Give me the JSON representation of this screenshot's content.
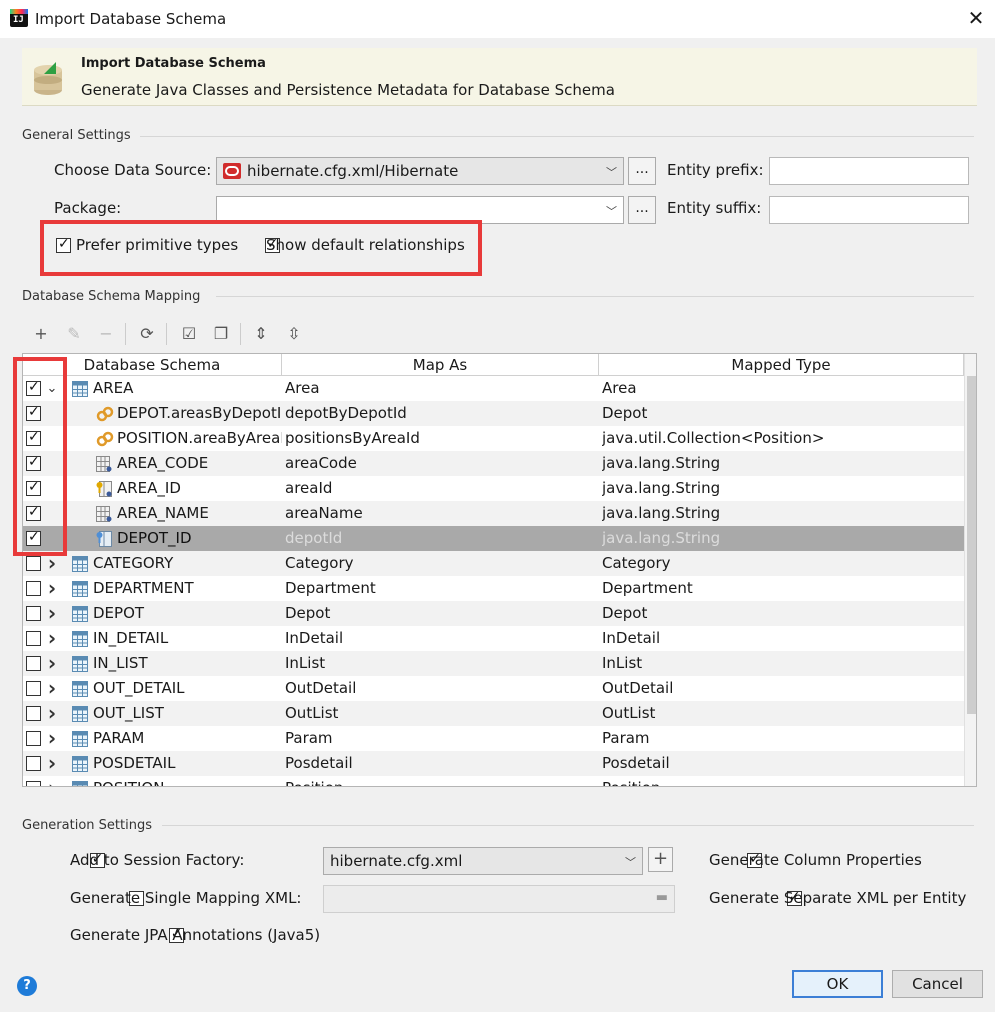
{
  "window": {
    "title": "Import Database Schema",
    "close_glyph": "✕"
  },
  "banner": {
    "title": "Import Database Schema",
    "subtitle": "Generate Java Classes and Persistence Metadata for Database Schema"
  },
  "general": {
    "section_label": "General Settings",
    "data_source_label": "Choose Data Source:",
    "data_source_value": "hibernate.cfg.xml/Hibernate",
    "package_label": "Package:",
    "package_value": "",
    "entity_prefix_label": "Entity prefix:",
    "entity_prefix_value": "",
    "entity_suffix_label": "Entity suffix:",
    "entity_suffix_value": "",
    "browse_label": "...",
    "prefer_primitive": {
      "label": "Prefer primitive types",
      "checked": true
    },
    "show_default_rel": {
      "label": "Show default relationships",
      "checked": true
    }
  },
  "mapping": {
    "section_label": "Database Schema Mapping",
    "toolbar": [
      "add-icon",
      "edit-icon",
      "remove-icon",
      "refresh-icon",
      "check-all-icon",
      "uncheck-all-icon",
      "expand-all-icon",
      "collapse-all-icon"
    ],
    "columns": [
      "Database Schema",
      "Map As",
      "Mapped Type"
    ],
    "rows": [
      {
        "checked": true,
        "expand": "v",
        "indent": 0,
        "icon": "table",
        "schema": "AREA",
        "map_as": "Area",
        "type": "Area"
      },
      {
        "checked": true,
        "expand": "",
        "indent": 1,
        "icon": "relation",
        "schema": "DEPOT.areasByDepotId",
        "map_as": "depotByDepotId",
        "type": "Depot"
      },
      {
        "checked": true,
        "expand": "",
        "indent": 1,
        "icon": "relation",
        "schema": "POSITION.areaByAreaId",
        "map_as": "positionsByAreaId",
        "type": "java.util.Collection<Position>"
      },
      {
        "checked": true,
        "expand": "",
        "indent": 1,
        "icon": "column",
        "schema": "AREA_CODE",
        "map_as": "areaCode",
        "type": "java.lang.String"
      },
      {
        "checked": true,
        "expand": "",
        "indent": 1,
        "icon": "key-column",
        "schema": "AREA_ID",
        "map_as": "areaId",
        "type": "java.lang.String"
      },
      {
        "checked": true,
        "expand": "",
        "indent": 1,
        "icon": "column",
        "schema": "AREA_NAME",
        "map_as": "areaName",
        "type": "java.lang.String"
      },
      {
        "checked": true,
        "expand": "",
        "indent": 1,
        "icon": "fk-column",
        "schema": "DEPOT_ID",
        "map_as": "depotId",
        "type": "java.lang.String",
        "selected": true
      },
      {
        "checked": false,
        "expand": ">",
        "indent": 0,
        "icon": "table",
        "schema": "CATEGORY",
        "map_as": "Category",
        "type": "Category"
      },
      {
        "checked": false,
        "expand": ">",
        "indent": 0,
        "icon": "table",
        "schema": "DEPARTMENT",
        "map_as": "Department",
        "type": "Department"
      },
      {
        "checked": false,
        "expand": ">",
        "indent": 0,
        "icon": "table",
        "schema": "DEPOT",
        "map_as": "Depot",
        "type": "Depot"
      },
      {
        "checked": false,
        "expand": ">",
        "indent": 0,
        "icon": "table",
        "schema": "IN_DETAIL",
        "map_as": "InDetail",
        "type": "InDetail"
      },
      {
        "checked": false,
        "expand": ">",
        "indent": 0,
        "icon": "table",
        "schema": "IN_LIST",
        "map_as": "InList",
        "type": "InList"
      },
      {
        "checked": false,
        "expand": ">",
        "indent": 0,
        "icon": "table",
        "schema": "OUT_DETAIL",
        "map_as": "OutDetail",
        "type": "OutDetail"
      },
      {
        "checked": false,
        "expand": ">",
        "indent": 0,
        "icon": "table",
        "schema": "OUT_LIST",
        "map_as": "OutList",
        "type": "OutList"
      },
      {
        "checked": false,
        "expand": ">",
        "indent": 0,
        "icon": "table",
        "schema": "PARAM",
        "map_as": "Param",
        "type": "Param"
      },
      {
        "checked": false,
        "expand": ">",
        "indent": 0,
        "icon": "table",
        "schema": "POSDETAIL",
        "map_as": "Posdetail",
        "type": "Posdetail"
      },
      {
        "checked": false,
        "expand": ">",
        "indent": 0,
        "icon": "table",
        "schema": "POSITION",
        "map_as": "Position",
        "type": "Position"
      }
    ]
  },
  "generation": {
    "section_label": "Generation Settings",
    "add_session_factory": {
      "label": "Add to Session Factory:",
      "checked": true
    },
    "session_factory_value": "hibernate.cfg.xml",
    "single_mapping_xml": {
      "label": "Generate Single Mapping XML:",
      "checked": false
    },
    "jpa_annotations": {
      "label": "Generate JPA Annotations (Java5)",
      "checked": true
    },
    "column_properties": {
      "label": "Generate Column Properties",
      "checked": true
    },
    "separate_xml": {
      "label": "Generate Separate XML per Entity",
      "checked": true
    },
    "plus_label": "+"
  },
  "buttons": {
    "help": "?",
    "ok": "OK",
    "cancel": "Cancel"
  },
  "colors": {
    "highlight_red": "#e83a3a",
    "selection_gray": "#a9a9a9",
    "banner_bg": "#f6f5e6",
    "ok_border": "#3c7fd6"
  }
}
